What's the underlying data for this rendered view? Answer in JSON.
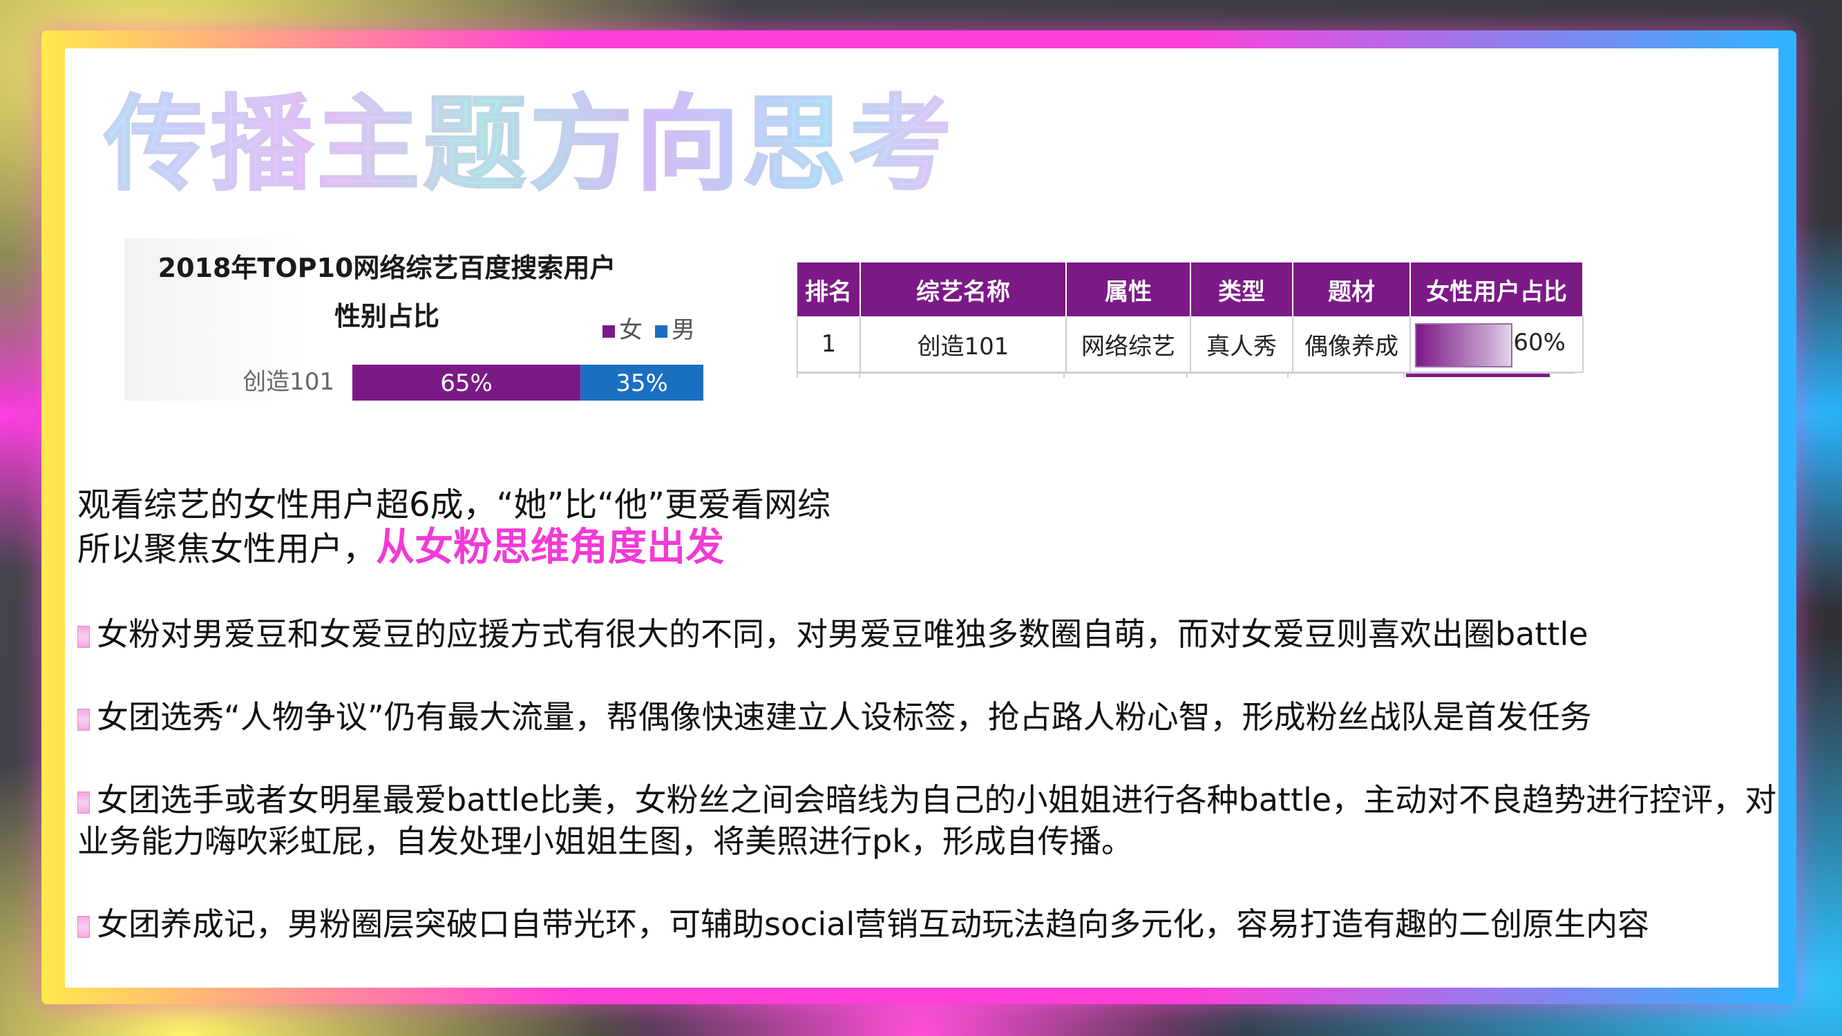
{
  "title": "传播主题方向思考",
  "chart_data": {
    "type": "bar",
    "title": "2018年TOP10网络综艺百度搜索用户性别占比",
    "title_line1": "2018年TOP10网络综艺百度搜索用户",
    "title_line2": "性别占比",
    "categories": [
      "创造101"
    ],
    "series": [
      {
        "name": "女",
        "values": [
          65
        ],
        "label": "65%",
        "color": "#7b1a86"
      },
      {
        "name": "男",
        "values": [
          35
        ],
        "label": "35%",
        "color": "#1a6fc0"
      }
    ],
    "stacked": true,
    "legend_position": "top-right"
  },
  "table": {
    "headers": [
      "排名",
      "综艺名称",
      "属性",
      "类型",
      "题材",
      "女性用户占比"
    ],
    "rows": [
      {
        "rank": "1",
        "name": "创造101",
        "attr": "网络综艺",
        "type": "真人秀",
        "theme": "偶像养成",
        "female_pct": "60%",
        "female_value": 60
      }
    ],
    "bar_color": "#7b1a86"
  },
  "intro": {
    "line1": "观看综艺的女性用户超6成，“她”比“他”更爱看网综",
    "line2_prefix": "所以聚焦女性用户，",
    "line2_highlight": "从女粉思维角度出发"
  },
  "bullets": [
    "女粉对男爱豆和女爱豆的应援方式有很大的不同，对男爱豆唯独多数圈自萌，而对女爱豆则喜欢出圈battle",
    "女团选秀“人物争议”仍有最大流量，帮偶像快速建立人设标签，抢占路人粉心智，形成粉丝战队是首发任务",
    "女团选手或者女明星最爱battle比美，女粉丝之间会暗线为自己的小姐姐进行各种battle，主动对不良趋势进行控评，对业务能力嗨吹彩虹屁，自发处理小姐姐生图，将美照进行pk，形成自传播。",
    "女团养成记，男粉圈层突破口自带光环，可辅助social营销互动玩法趋向多元化，容易打造有趣的二创原生内容"
  ],
  "colors": {
    "accent_pink": "#f23ad6",
    "table_header": "#7b1a86"
  }
}
